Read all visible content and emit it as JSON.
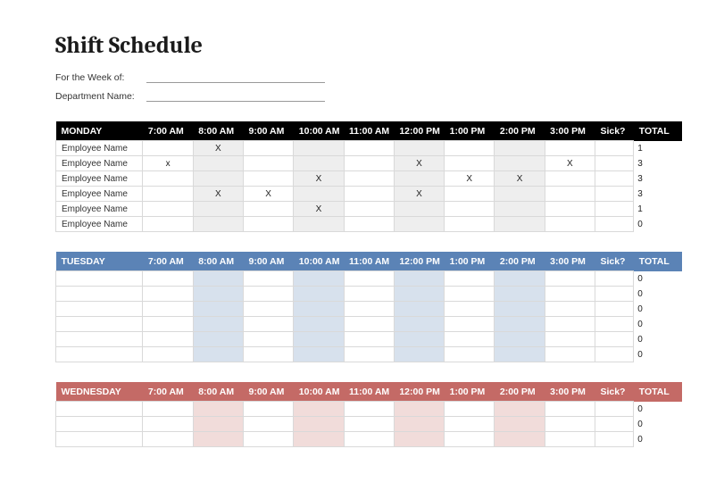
{
  "title": "Shift Schedule",
  "meta": {
    "week_label": "For the Week of:",
    "week_value": "",
    "dept_label": "Department Name:",
    "dept_value": ""
  },
  "time_slots": [
    "7:00 AM",
    "8:00 AM",
    "9:00 AM",
    "10:00 AM",
    "11:00 AM",
    "12:00 PM",
    "1:00 PM",
    "2:00 PM",
    "3:00 PM"
  ],
  "sick_header": "Sick?",
  "total_header": "TOTAL",
  "shaded_slot_indices": [
    1,
    3,
    5,
    7
  ],
  "days": [
    {
      "name": "MONDAY",
      "theme": "black",
      "shade_class": "shade-grey",
      "rows": [
        {
          "label": "Employee Name",
          "marks": [
            "",
            "X",
            "",
            "",
            "",
            "",
            "",
            "",
            ""
          ],
          "sick": "",
          "total": "1"
        },
        {
          "label": "Employee Name",
          "marks": [
            "x",
            "",
            "",
            "",
            "",
            "X",
            "",
            "",
            "X"
          ],
          "sick": "",
          "total": "3"
        },
        {
          "label": "Employee Name",
          "marks": [
            "",
            "",
            "",
            "X",
            "",
            "",
            "X",
            "X",
            ""
          ],
          "sick": "",
          "total": "3"
        },
        {
          "label": "Employee Name",
          "marks": [
            "",
            "X",
            "X",
            "",
            "",
            "X",
            "",
            "",
            ""
          ],
          "sick": "",
          "total": "3"
        },
        {
          "label": "Employee Name",
          "marks": [
            "",
            "",
            "",
            "X",
            "",
            "",
            "",
            "",
            ""
          ],
          "sick": "",
          "total": "1"
        },
        {
          "label": "Employee Name",
          "marks": [
            "",
            "",
            "",
            "",
            "",
            "",
            "",
            "",
            ""
          ],
          "sick": "",
          "total": "0"
        }
      ]
    },
    {
      "name": "TUESDAY",
      "theme": "blue",
      "shade_class": "shade-blue",
      "rows": [
        {
          "label": "",
          "marks": [
            "",
            "",
            "",
            "",
            "",
            "",
            "",
            "",
            ""
          ],
          "sick": "",
          "total": "0"
        },
        {
          "label": "",
          "marks": [
            "",
            "",
            "",
            "",
            "",
            "",
            "",
            "",
            ""
          ],
          "sick": "",
          "total": "0"
        },
        {
          "label": "",
          "marks": [
            "",
            "",
            "",
            "",
            "",
            "",
            "",
            "",
            ""
          ],
          "sick": "",
          "total": "0"
        },
        {
          "label": "",
          "marks": [
            "",
            "",
            "",
            "",
            "",
            "",
            "",
            "",
            ""
          ],
          "sick": "",
          "total": "0"
        },
        {
          "label": "",
          "marks": [
            "",
            "",
            "",
            "",
            "",
            "",
            "",
            "",
            ""
          ],
          "sick": "",
          "total": "0"
        },
        {
          "label": "",
          "marks": [
            "",
            "",
            "",
            "",
            "",
            "",
            "",
            "",
            ""
          ],
          "sick": "",
          "total": "0"
        }
      ]
    },
    {
      "name": "WEDNESDAY",
      "theme": "red",
      "shade_class": "shade-red",
      "rows": [
        {
          "label": "",
          "marks": [
            "",
            "",
            "",
            "",
            "",
            "",
            "",
            "",
            ""
          ],
          "sick": "",
          "total": "0"
        },
        {
          "label": "",
          "marks": [
            "",
            "",
            "",
            "",
            "",
            "",
            "",
            "",
            ""
          ],
          "sick": "",
          "total": "0"
        },
        {
          "label": "",
          "marks": [
            "",
            "",
            "",
            "",
            "",
            "",
            "",
            "",
            ""
          ],
          "sick": "",
          "total": "0"
        }
      ]
    }
  ]
}
